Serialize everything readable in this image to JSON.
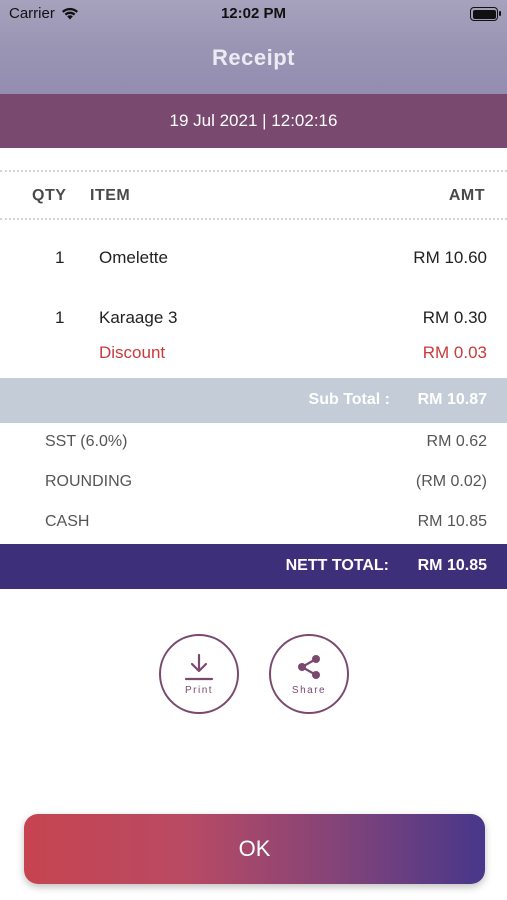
{
  "status_bar": {
    "carrier": "Carrier",
    "time": "12:02 PM"
  },
  "header": {
    "title": "Receipt"
  },
  "datetime": "19 Jul 2021 | 12:02:16",
  "columns": {
    "qty": "QTY",
    "item": "ITEM",
    "amount": "AMT"
  },
  "items": [
    {
      "qty": "1",
      "name": "Omelette",
      "amount": "RM 10.60"
    },
    {
      "qty": "1",
      "name": "Karaage 3",
      "amount": "RM 0.30"
    }
  ],
  "discount": {
    "label": "Discount",
    "amount": "RM 0.03"
  },
  "subtotal": {
    "label": "Sub Total :",
    "amount": "RM 10.87"
  },
  "charges": [
    {
      "label": "SST (6.0%)",
      "amount": "RM 0.62"
    },
    {
      "label": "ROUNDING",
      "amount": "(RM 0.02)"
    },
    {
      "label": "CASH",
      "amount": "RM 10.85"
    }
  ],
  "nett_total": {
    "label": "NETT TOTAL:",
    "amount": "RM 10.85"
  },
  "actions": {
    "print": "Print",
    "share": "Share"
  },
  "ok_button": "OK",
  "colors": {
    "datebar": "#7a4970",
    "subtotal_bg": "#c3ccd7",
    "nett_bg": "#3d2f7a",
    "discount": "#c93a3a"
  },
  "icons": {
    "print": "download-icon",
    "share": "share-icon",
    "wifi": "wifi-icon",
    "battery": "battery-icon"
  }
}
